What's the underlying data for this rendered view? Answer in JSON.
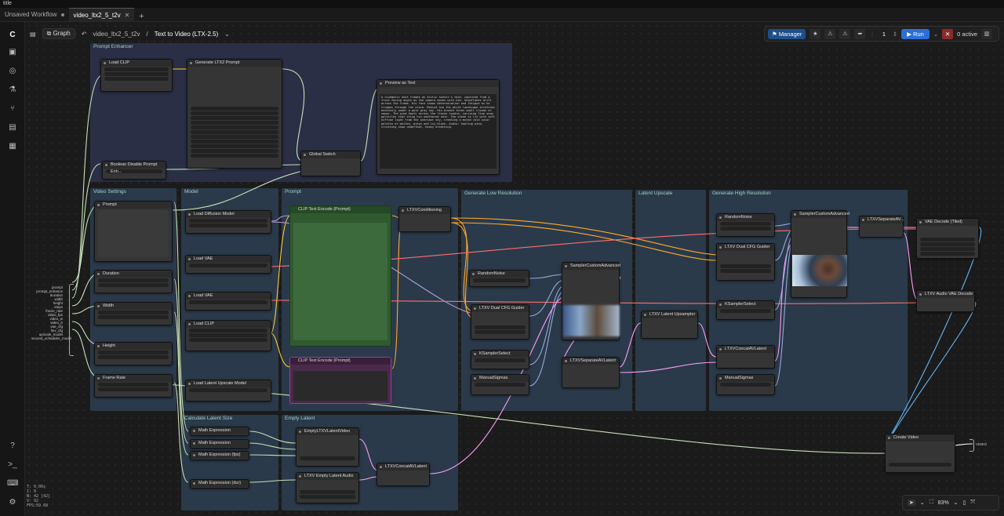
{
  "app": {
    "title": "title"
  },
  "tabs": [
    {
      "label": "Unsaved Workflow"
    },
    {
      "label": "video_ltx2_5_t2v"
    }
  ],
  "topbar": {
    "graph_label": "Graph",
    "breadcrumb": "video_ltx2_5_t2v",
    "workflow_title": "Text to Video (LTX-2.5)"
  },
  "toolbar": {
    "manager_label": "Manager",
    "batch_count": "1",
    "run_label": "Run",
    "active_label": "0 active"
  },
  "zoom": {
    "level": "83%"
  },
  "stats": [
    "T: 0.00s",
    "I: 0",
    "N: 42 [42]",
    "V: 92",
    "FPS:59.68"
  ],
  "groups": [
    {
      "title": "Prompt Enhancer"
    },
    {
      "title": "Video Settings"
    },
    {
      "title": "Model"
    },
    {
      "title": "Prompt"
    },
    {
      "title": "Generate Low Resolution"
    },
    {
      "title": "Latent Upscale"
    },
    {
      "title": "Generate High Resolution"
    },
    {
      "title": "Calculate Latent Size"
    },
    {
      "title": "Empty Latent"
    }
  ],
  "nodes": {
    "load_clip": "Load CLIP",
    "gen_prompt": "Generate LTX2 Prompt",
    "preview_text": "Preview as Text",
    "bool_switch": "Boolean Disable Prompt Enh...",
    "global_switch": "Global Switch",
    "prompt": "Prompt",
    "duration": "Duration",
    "width": "Width",
    "height": "Height",
    "frame_rate": "Frame Rate",
    "load_diffusion": "Load Diffusion Model",
    "load_vae": "Load VAE",
    "load_vae2": "Load VAE",
    "load_clip2": "Load CLIP",
    "load_upscale": "Load Latent Upscale Model",
    "clip_pos": "CLIP Text Encode (Prompt)",
    "clip_neg": "CLIP Text Encode (Prompt)",
    "ltxv_cond": "LTXVConditioning",
    "sampler_custom": "SamplerCustomAdvanced",
    "random_noise": "RandomNoise",
    "guider": "LTXV Dual CFG Guider",
    "ksampler_select": "KSamplerSelect",
    "manual_sigmas": "ManualSigmas",
    "separate_av": "LTXVSeparateAVLatent",
    "latent_upsampler": "LTXV Latent Upsampler",
    "random_noise2": "RandomNoise",
    "guider2": "LTXV Dual CFG Guider",
    "ksampler_select2": "KSamplerSelect",
    "concat2": "LTXVConcatAVLatent",
    "manual_sigmas2": "ManualSigmas",
    "sampler_custom2": "SamplerCustomAdvanced",
    "separate2": "LTXVSeparateAV...",
    "vae_decode": "VAE Decode (Tiled)",
    "audio_decode": "LTXV Audio VAE Decode",
    "create_video": "Create Video",
    "math1": "Math Expression",
    "math2": "Math Expression",
    "math3": "Math Expression (fps)",
    "math4": "Math Expression (dur)",
    "empty_latent": "EmptyLTXVLatentVideo",
    "empty_audio": "LTXV Empty Latent Audio",
    "concat": "LTXVConcatAVLatent"
  },
  "left_pins": [
    "prompt",
    "prompt_enhance",
    "duration",
    "width",
    "height",
    "steps",
    "frame_rate",
    "video_fps",
    "video_w",
    "video_h",
    "vae_cfg",
    "ltxv_cfg",
    "upscale_model",
    "second_scheduler_model"
  ],
  "preview_text_body": "A cinematic shot frames an Arctic hunter's face, captured from a front-facing angle as the camera moves with him. Snowflakes drift across the frame. His face shows determination and fatigue as he trudges through the storm. Behind him the white landscape stretches endlessly under a pale grey sky. His breath forms small clouds of vapor. The wind howls across the frozen tundra, carrying fine snow particles that sting his weathered skin. The scene is lit with soft diffuse light from the overcast sky, creating a muted cold color palette of whites, greys and icy blues. Audio: howling wind, crunching snow underfoot, heavy breathing.",
  "widgets": {
    "sampler": "euler_ancestral",
    "sigmas": "1.0, 0.99375, 0.9875, 0.98125, 0.975, 0.909375, 0.725, 0.421875, 0.0",
    "sigmas2": "0.85, 0.7250, 0.4219, 0.0"
  },
  "create_video_out": "VIDEO"
}
